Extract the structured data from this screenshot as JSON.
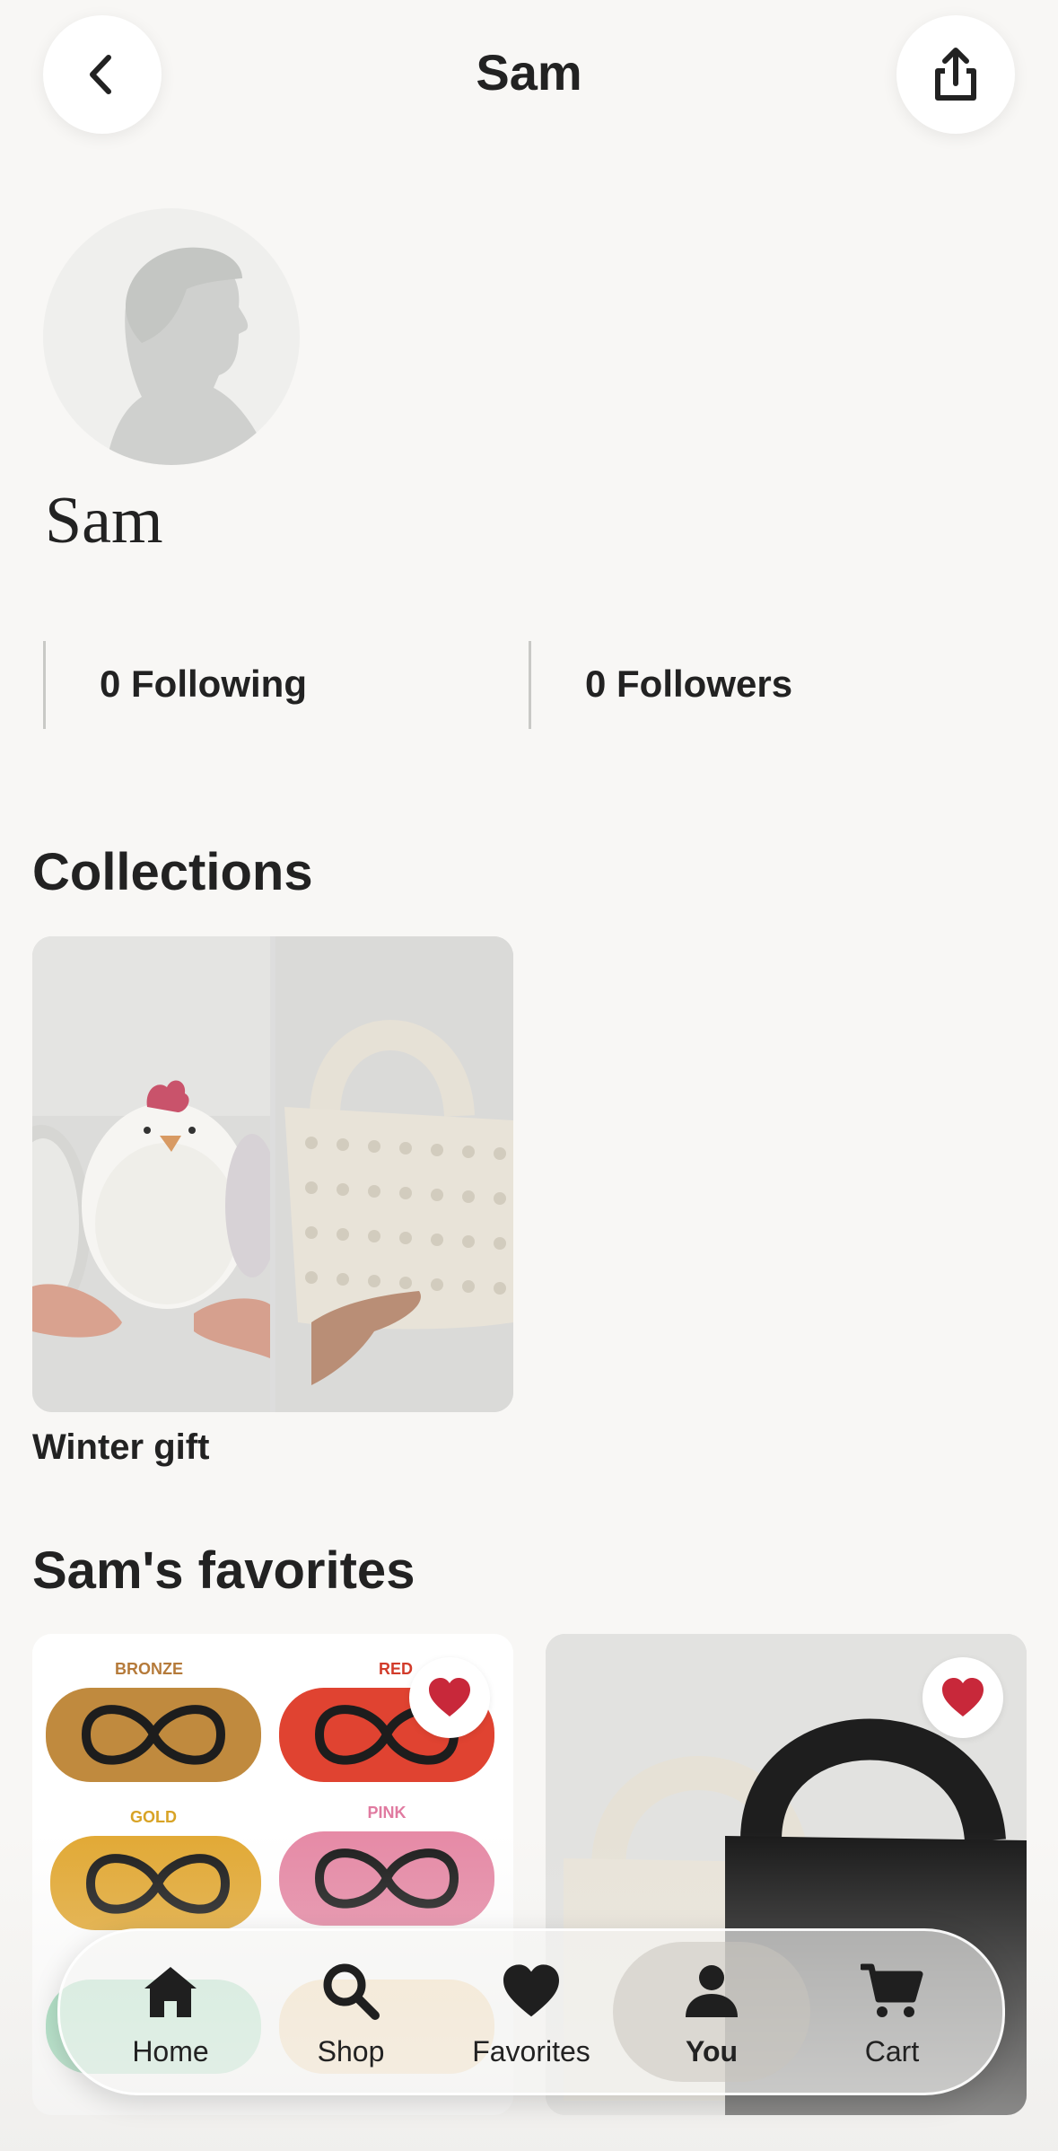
{
  "header": {
    "title": "Sam",
    "back_icon": "chevron-left-icon",
    "share_icon": "share-icon"
  },
  "profile": {
    "name": "Sam",
    "following": "0 Following",
    "followers": "0 Followers"
  },
  "collections": {
    "heading": "Collections",
    "items": [
      {
        "name": "Winter gift"
      }
    ]
  },
  "favorites": {
    "heading": "Sam's favorites",
    "items": [
      {
        "labels": [
          "BRONZE",
          "RED",
          "GOLD",
          "PINK"
        ],
        "favorited": true
      },
      {
        "favorited": true
      }
    ]
  },
  "tabbar": {
    "active": "You",
    "items": [
      {
        "label": "Home",
        "icon": "home-icon"
      },
      {
        "label": "Shop",
        "icon": "search-icon"
      },
      {
        "label": "Favorites",
        "icon": "heart-icon"
      },
      {
        "label": "You",
        "icon": "person-icon"
      },
      {
        "label": "Cart",
        "icon": "cart-icon"
      }
    ]
  },
  "colors": {
    "background": "#f8f7f5",
    "text": "#222222",
    "heart": "#c8283a",
    "avatar_bg": "#efefed",
    "avatar_fg": "#cfd0ce"
  }
}
